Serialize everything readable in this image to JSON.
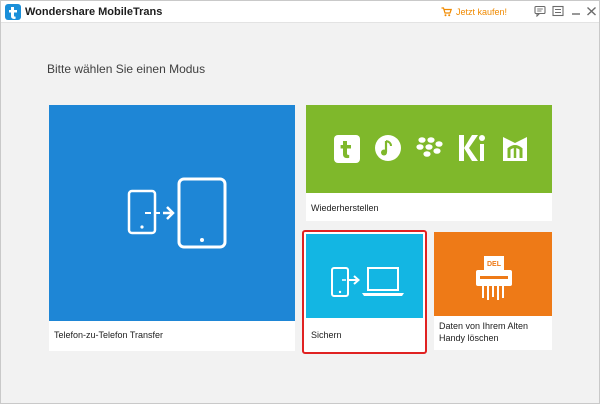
{
  "window": {
    "title": "Wondershare MobileTrans",
    "buy_label": "Jetzt kaufen!"
  },
  "main": {
    "heading": "Bitte wählen Sie einen Modus"
  },
  "tiles": [
    {
      "id": "transfer",
      "label": "Telefon-zu-Telefon Transfer",
      "color": "#1e86d6",
      "icon": "phone-transfer-icon"
    },
    {
      "id": "restore",
      "label": "Wiederherstellen",
      "color": "#7fb82b",
      "icons": [
        "tunes-icon",
        "music-icon",
        "blackberry-icon",
        "kies-icon",
        "mobiletrans-icon"
      ]
    },
    {
      "id": "backup",
      "label": "Sichern",
      "color": "#13b6e3",
      "icon": "phone-to-laptop-icon",
      "selected": true
    },
    {
      "id": "erase",
      "label_line1": "Daten von Ihrem Alten",
      "label_line2": "Handy löschen",
      "color": "#ee7a17",
      "icon": "shredder-icon"
    }
  ],
  "colors": {
    "accent_orange": "#f08a00",
    "selection_red": "#e02222"
  }
}
